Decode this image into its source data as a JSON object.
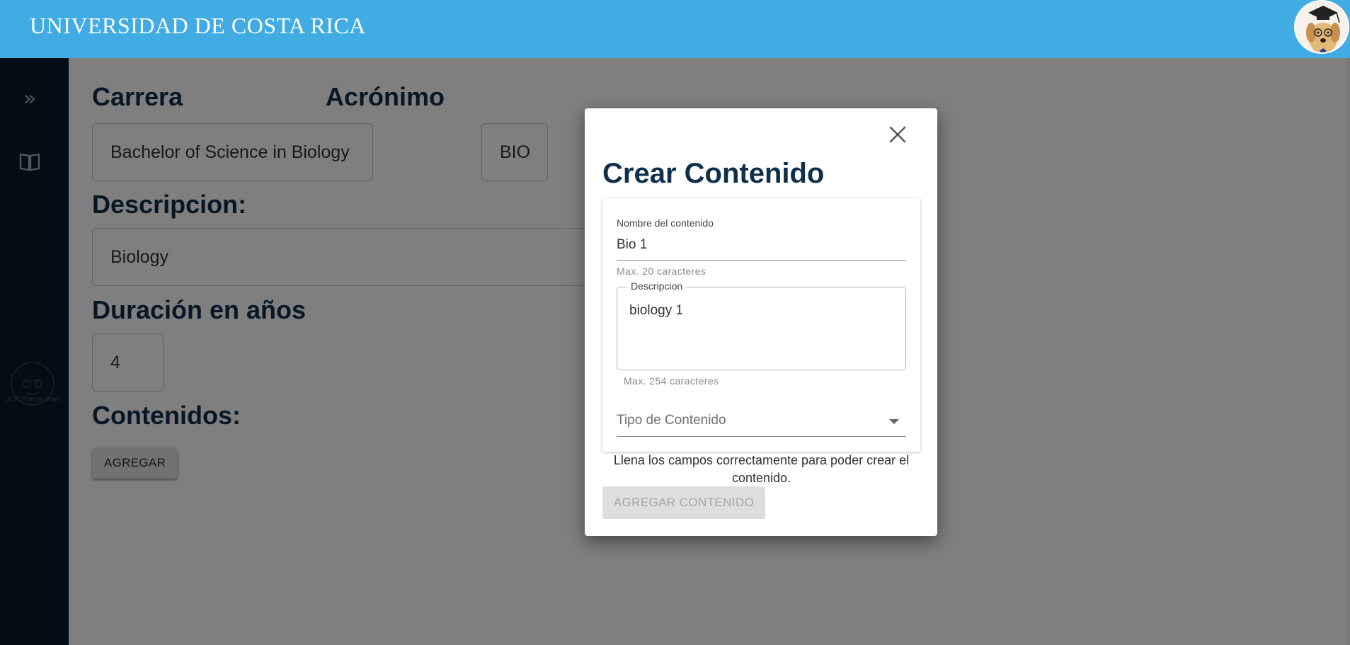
{
  "header": {
    "brand": "UNIVERSIDAD DE COSTA RICA",
    "accent_color": "#41ace4",
    "avatar_icon": "dog-graduate-avatar"
  },
  "sidebar": {
    "background": "#061b2c",
    "expand_icon": "double-chevron-right-icon",
    "expand_glyph": "»",
    "book_icon": "open-book-icon",
    "logo_text": "UCR Theme Park"
  },
  "form": {
    "carrera_label": "Carrera",
    "carrera_value": "Bachelor of Science in Biology",
    "acronimo_label": "Acrónimo",
    "acronimo_value": "BIO",
    "descripcion_label": "Descripcion:",
    "descripcion_value": "Biology",
    "duracion_label": "Duración en años",
    "duracion_value": "4",
    "contenidos_label": "Contenidos:",
    "agregar_label": "AGREGAR"
  },
  "dialog": {
    "title": "Crear Contenido",
    "close_icon": "close-icon",
    "nombre_label": "Nombre del contenido",
    "nombre_value": "Bio 1",
    "nombre_help": "Max. 20 caracteres",
    "descripcion_legend": "Descripcion",
    "descripcion_value": "biology 1",
    "descripcion_help": "Max. 254 caracteres",
    "tipo_placeholder": "Tipo de Contenido",
    "hint": "Llena los campos correctamente para poder crear el contenido.",
    "submit_label": "AGREGAR CONTENIDO"
  }
}
